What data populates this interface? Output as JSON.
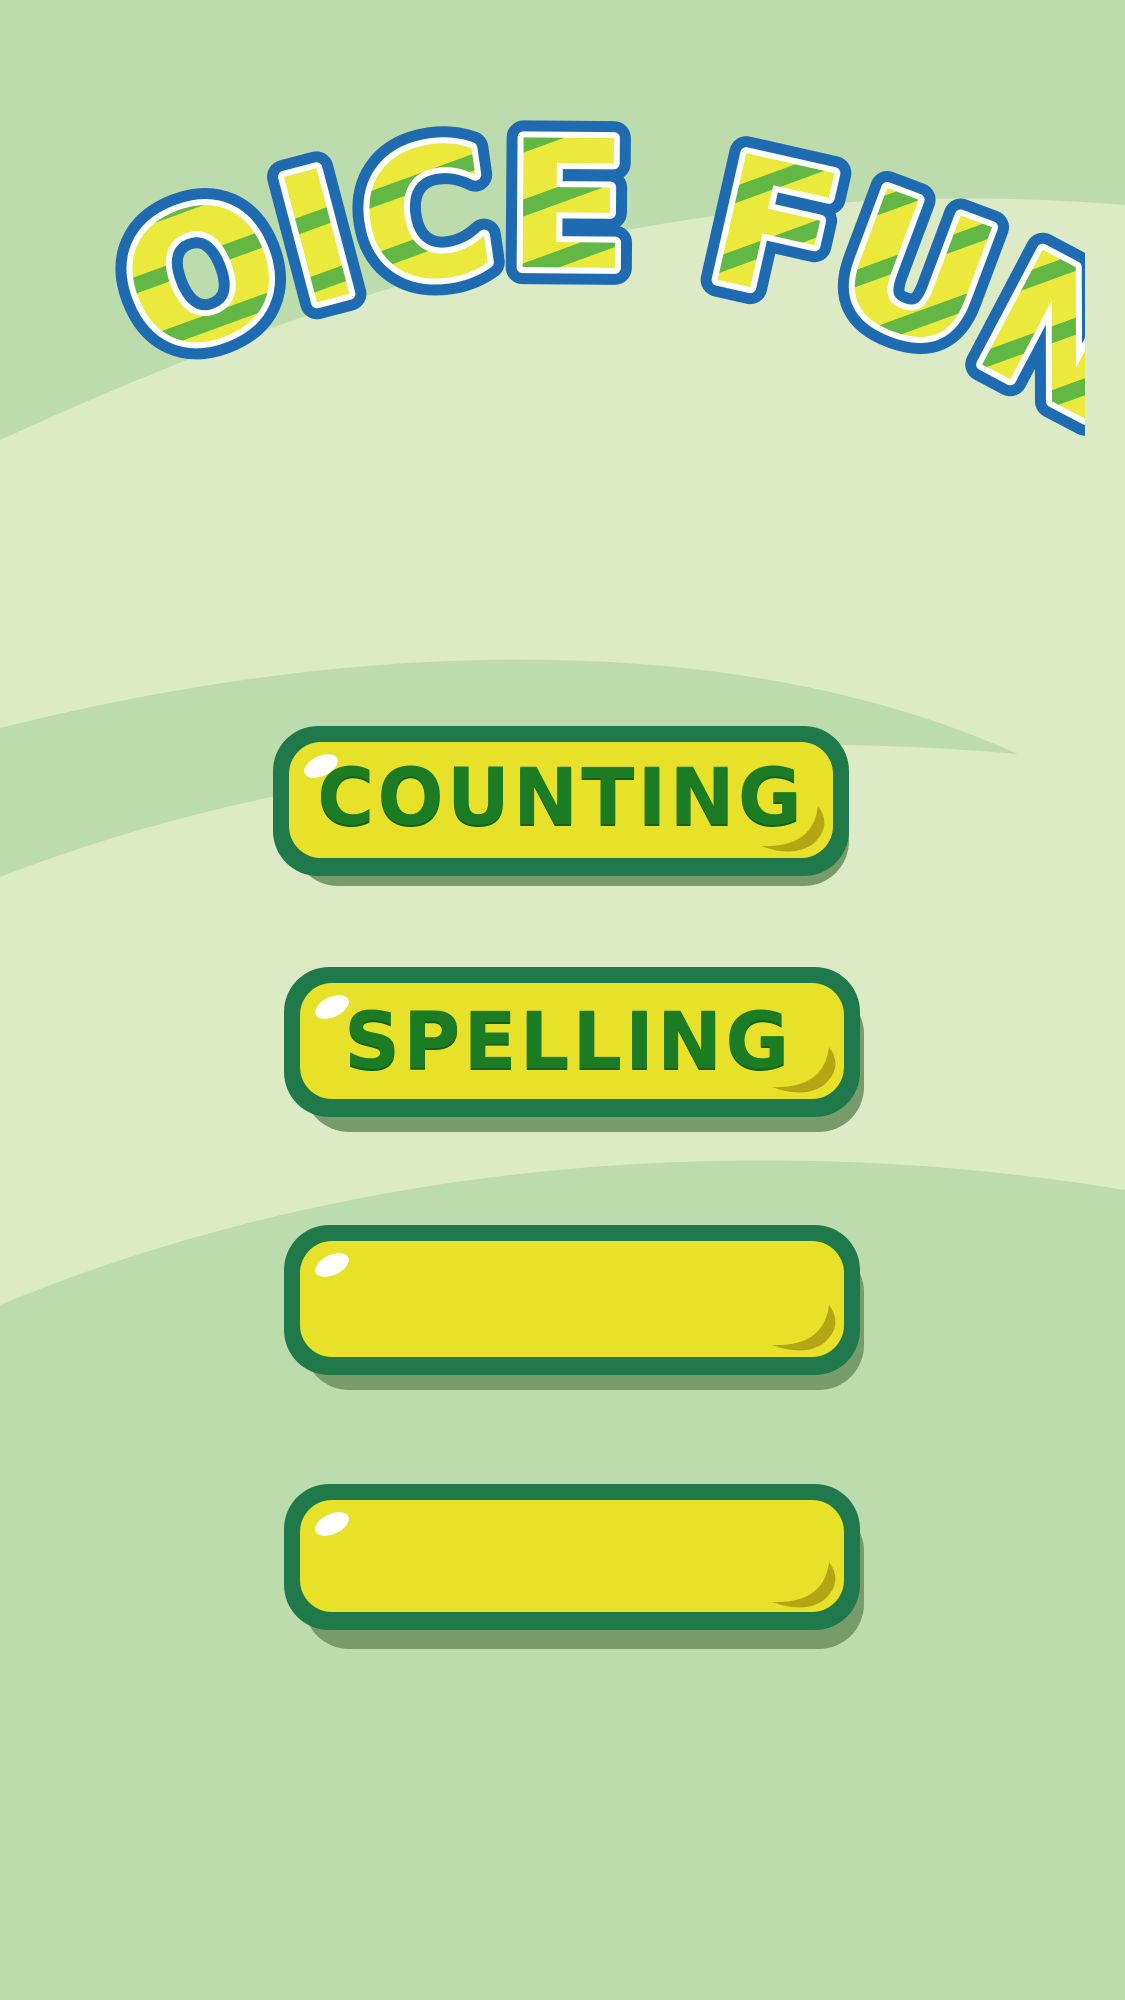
{
  "title": "VOICE FUN",
  "menu": {
    "buttons": [
      {
        "label": "COUNTING"
      },
      {
        "label": "SPELLING"
      },
      {
        "label": ""
      },
      {
        "label": ""
      }
    ]
  },
  "colors": {
    "background_dark": "#bcdcae",
    "background_light": "#dcebc6",
    "title_fill": "#eae93c",
    "title_stripe": "#63b744",
    "title_outline": "#1f6bb2",
    "button_fill": "#e8e12a",
    "button_border": "#20794a",
    "button_shadow": "#779c6a",
    "button_text": "#1b7c24"
  }
}
